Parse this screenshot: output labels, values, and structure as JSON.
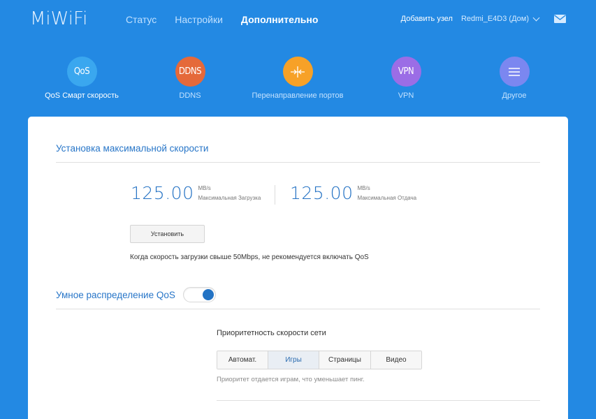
{
  "header": {
    "logo": "MiWiFi",
    "nav": [
      {
        "label": "Статус"
      },
      {
        "label": "Настройки"
      },
      {
        "label": "Дополнительно"
      }
    ],
    "add_node": "Добавить узел",
    "router_name": "Redmi_E4D3 (Дом)",
    "mail_icon": "mail-icon"
  },
  "features": [
    {
      "icon_text": "QoS",
      "label": "QoS Смарт скорость",
      "color": "#3aa7ef"
    },
    {
      "icon_text": "DDNS",
      "label": "DDNS",
      "color": "#e5693a"
    },
    {
      "icon_text": "",
      "label": "Перенаправление портов",
      "color": "#f7a127",
      "icon": "port-forwarding-icon"
    },
    {
      "icon_text": "VPN",
      "label": "VPN",
      "color": "#9b6de6"
    },
    {
      "icon_text": "",
      "label": "Другое",
      "color": "#7b87f0",
      "icon": "menu-icon"
    }
  ],
  "speed": {
    "section_title": "Установка максимальной скорости",
    "download": {
      "value": "125.00",
      "unit": "MB/s",
      "caption": "Максимальная Загрузка"
    },
    "upload": {
      "value": "125.00",
      "unit": "MB/s",
      "caption": "Максимальная Отдача"
    },
    "set_button": "Установить",
    "hint": "Когда скорость загрузки свыше 50Mbps, не рекомендуется включать QoS"
  },
  "qos": {
    "title": "Умное распределение QoS",
    "enabled": true,
    "priority_title": "Приоритетность скорости сети",
    "options": [
      {
        "label": "Автомат."
      },
      {
        "label": "Игры"
      },
      {
        "label": "Страницы"
      },
      {
        "label": "Видео"
      }
    ],
    "selected": "Игры",
    "note": "Приоритет отдается играм, что уменьшает пинг."
  },
  "colors": {
    "background": "#2389e3",
    "accent": "#2876c8"
  }
}
